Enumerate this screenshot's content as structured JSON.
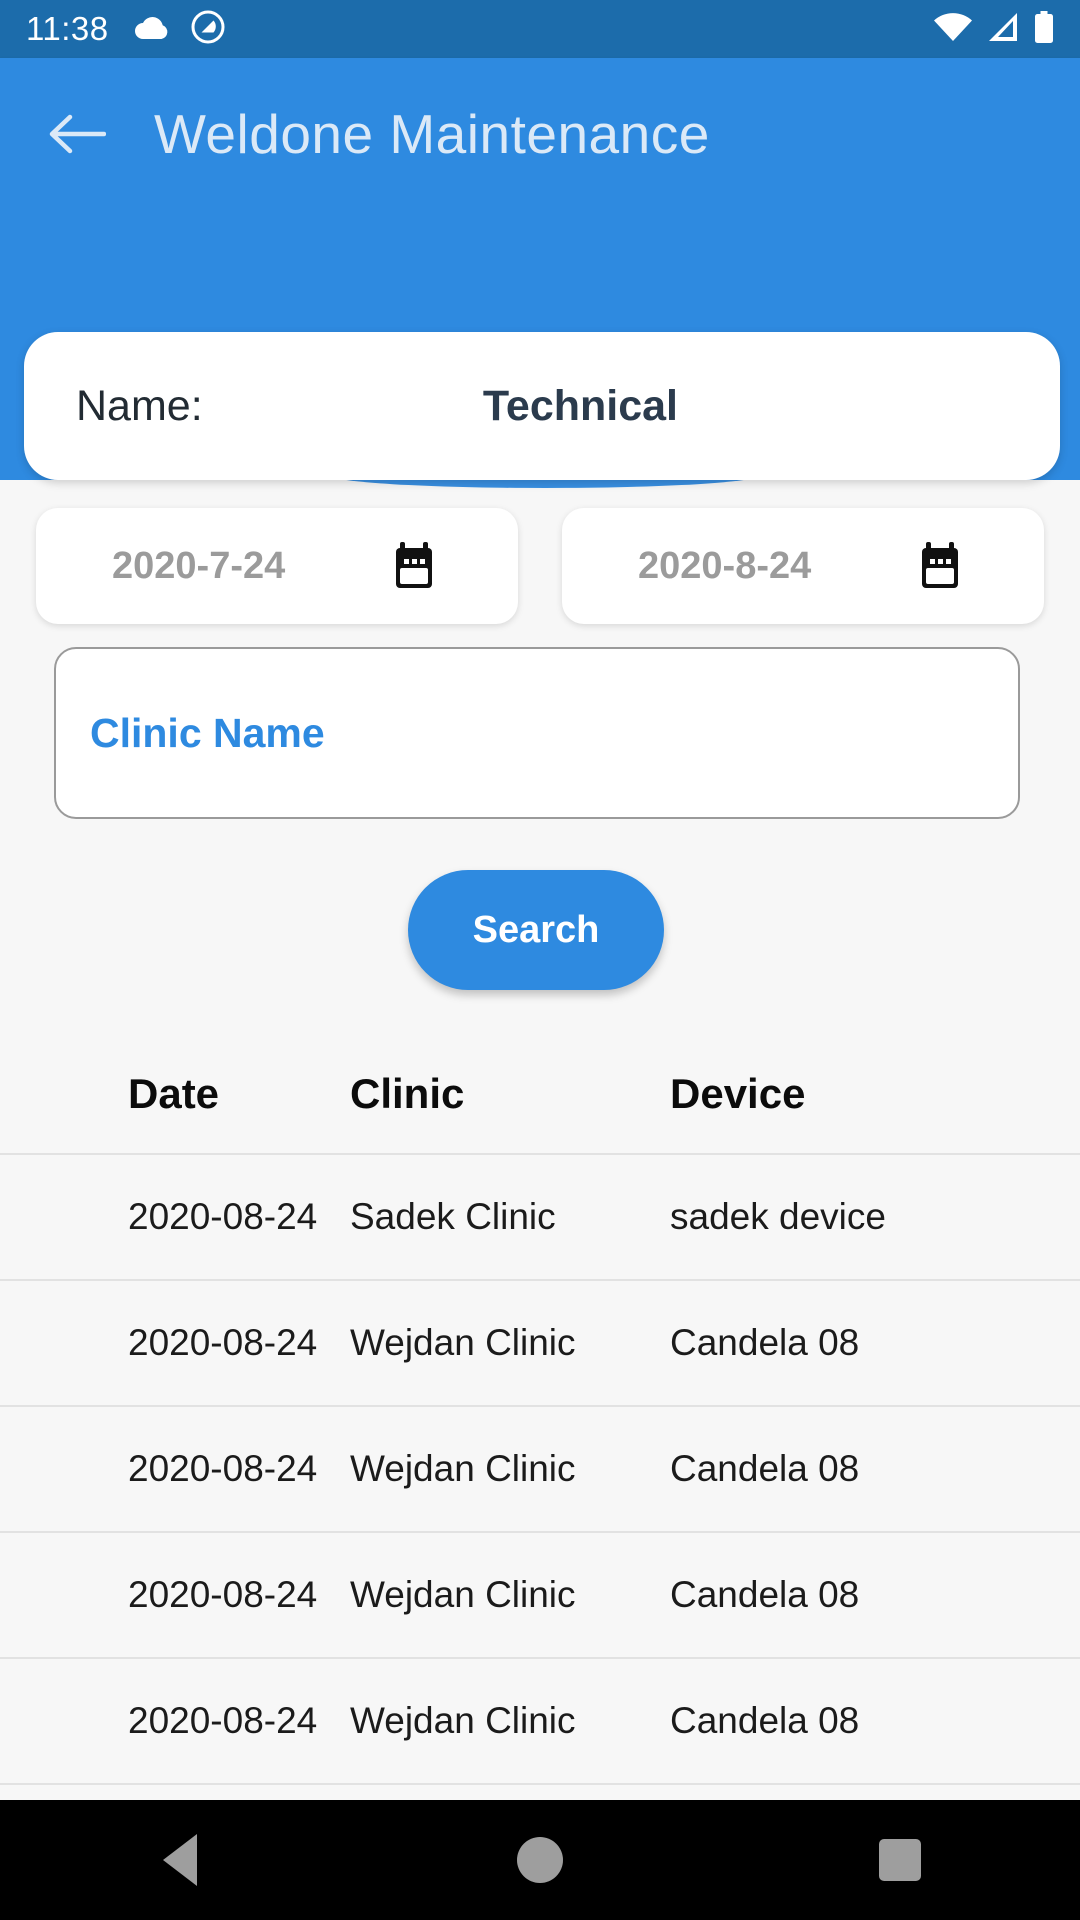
{
  "status_bar": {
    "time": "11:38",
    "left_icons": [
      "cloud-icon",
      "quickoffice-circle-icon"
    ],
    "right_icons": [
      "wifi-icon",
      "cellular-signal-icon",
      "battery-icon"
    ]
  },
  "app_bar": {
    "back_icon": "arrow-left-icon",
    "title": "Weldone Maintenance"
  },
  "name_card": {
    "label": "Name:",
    "value": "Technical"
  },
  "filters": {
    "date_from": "2020-7-24",
    "date_to": "2020-8-24",
    "date_icon": "calendar-icon",
    "clinic_placeholder": "Clinic Name",
    "clinic_value": "",
    "search_label": "Search"
  },
  "table": {
    "headers": [
      "Date",
      "Clinic",
      "Device"
    ],
    "rows": [
      {
        "date": "2020-08-24",
        "clinic": "Sadek Clinic",
        "device": "sadek device"
      },
      {
        "date": "2020-08-24",
        "clinic": "Wejdan Clinic",
        "device": "Candela   08"
      },
      {
        "date": "2020-08-24",
        "clinic": "Wejdan Clinic",
        "device": "Candela   08"
      },
      {
        "date": "2020-08-24",
        "clinic": "Wejdan Clinic",
        "device": "Candela   08"
      },
      {
        "date": "2020-08-24",
        "clinic": "Wejdan Clinic",
        "device": "Candela   08"
      }
    ]
  },
  "nav_bar": {
    "back": "nav-back-icon",
    "home": "nav-home-icon",
    "recents": "nav-recents-icon"
  },
  "colors": {
    "status_bar": "#1c6cab",
    "app_bar": "#2e8ae0",
    "accent": "#2e8ae0",
    "page_bg": "#f7f7f7",
    "nav_bar": "#000000"
  }
}
